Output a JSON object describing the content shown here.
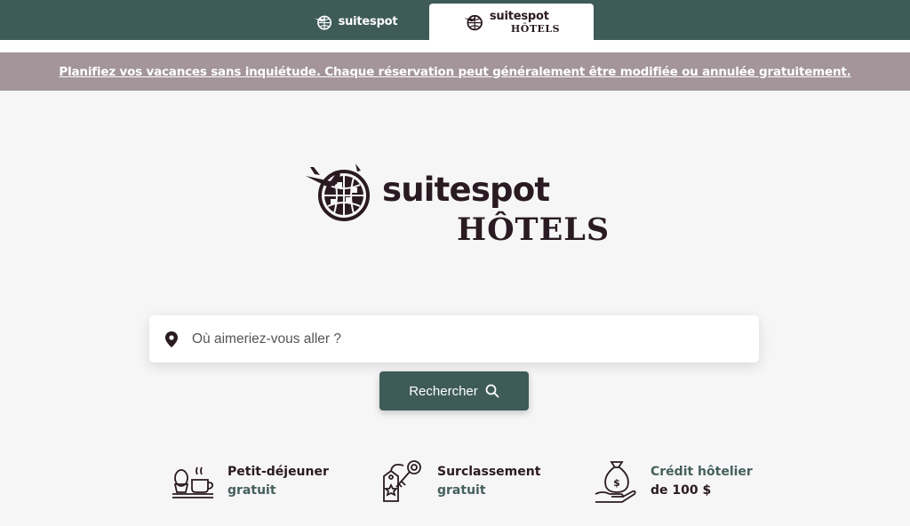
{
  "tabs": [
    {
      "label": "suitespot",
      "sub": ""
    },
    {
      "label": "suitespot",
      "sub": "HÔTELS"
    }
  ],
  "banner": {
    "text": "Planifiez vos vacances sans inquiétude. Chaque réservation peut généralement être modifiée ou annulée gratuitement."
  },
  "logo": {
    "name": "suitespot",
    "sub": "HÔTELS"
  },
  "search": {
    "placeholder": "Où aimeriez-vous aller ?",
    "value": "",
    "icon": "location-pin-icon"
  },
  "button": {
    "label": "Rechercher",
    "icon": "search-icon"
  },
  "features": [
    {
      "title": "Petit-déjeuner",
      "sub": "gratuit",
      "icon": "breakfast-icon"
    },
    {
      "title": "Surclassement",
      "sub": "gratuit",
      "icon": "key-tag-icon"
    },
    {
      "title": "Crédit hôtelier",
      "sub": "de 100 $",
      "icon": "money-bag-hand-icon"
    }
  ],
  "colors": {
    "brand": "#3e5b58",
    "banner": "#a39599",
    "text": "#2a1a22"
  }
}
